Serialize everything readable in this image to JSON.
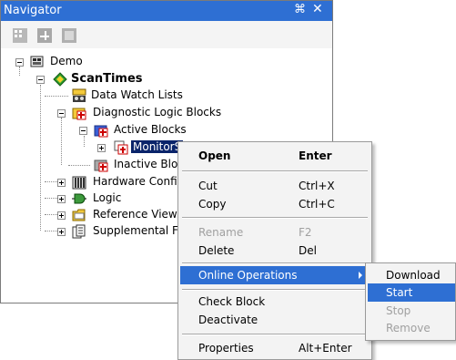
{
  "navigator": {
    "title": "Navigator",
    "pin_icon": "pin-icon",
    "close_icon": "close-icon"
  },
  "tree": {
    "demo": "Demo",
    "scantimes": "ScanTimes",
    "data_watch_lists": "Data Watch Lists",
    "diagnostic_logic_blocks": "Diagnostic Logic Blocks",
    "active_blocks": "Active Blocks",
    "monitor": "MonitorS",
    "inactive_blocks": "Inactive Bloc",
    "hardware_config": "Hardware Config",
    "logic": "Logic",
    "reference_view": "Reference View",
    "supplemental": "Supplemental Fil"
  },
  "context_menu": {
    "open": {
      "label": "Open",
      "shortcut": "Enter"
    },
    "cut": {
      "label": "Cut",
      "shortcut": "Ctrl+X"
    },
    "copy": {
      "label": "Copy",
      "shortcut": "Ctrl+C"
    },
    "rename": {
      "label": "Rename",
      "shortcut": "F2"
    },
    "delete": {
      "label": "Delete",
      "shortcut": "Del"
    },
    "online_operations": {
      "label": "Online Operations"
    },
    "check_block": {
      "label": "Check Block"
    },
    "deactivate": {
      "label": "Deactivate"
    },
    "properties": {
      "label": "Properties",
      "shortcut": "Alt+Enter"
    }
  },
  "submenu": {
    "download": "Download",
    "start": "Start",
    "stop": "Stop",
    "remove": "Remove"
  },
  "colors": {
    "title_bar": "#2e6fd3",
    "selection": "#0a246a",
    "menu_highlight": "#2e6fd3"
  }
}
